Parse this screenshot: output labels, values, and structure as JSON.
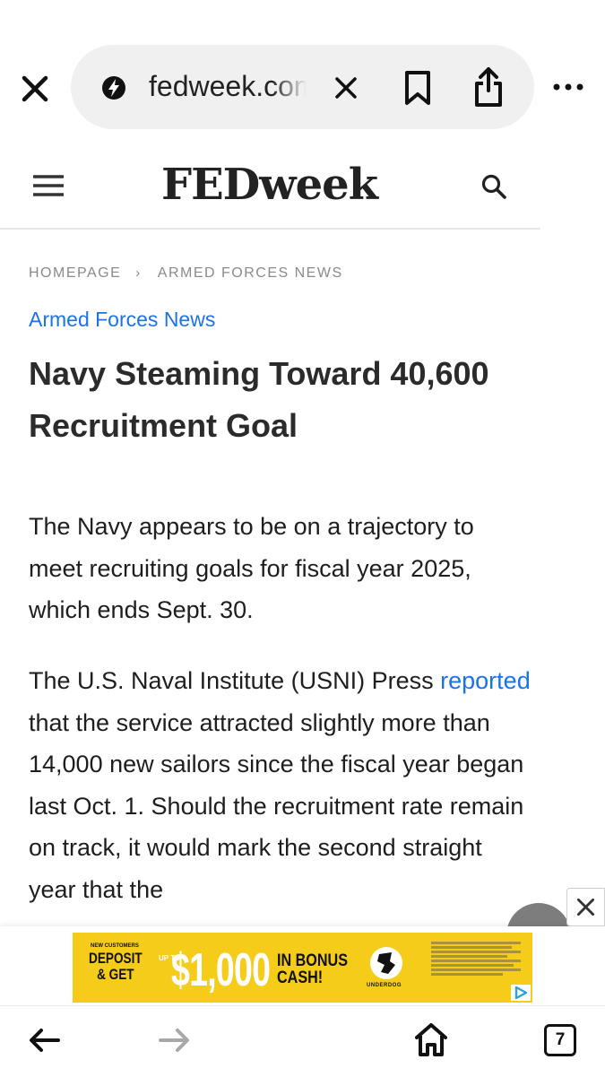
{
  "browser": {
    "url_text": "fedweek.com",
    "open_tabs_count": "7",
    "icons": {
      "close": "close-icon",
      "site_info": "lightning-bolt-icon",
      "clear_url": "clear-icon",
      "bookmark": "bookmark-icon",
      "share": "share-icon",
      "menu": "more-horizontal-icon",
      "back": "arrow-left-icon",
      "forward": "arrow-right-icon",
      "home": "home-icon"
    }
  },
  "site": {
    "logo_text": "FEDweek",
    "icons": {
      "menu": "hamburger-icon",
      "search": "search-icon"
    }
  },
  "breadcrumb": {
    "home": "HOMEPAGE",
    "separator": "›",
    "section": "ARMED FORCES NEWS"
  },
  "article": {
    "category": "Armed Forces News",
    "title": "Navy Steaming Toward 40,600 Recruitment Goal",
    "paragraph1": "The Navy appears to be on a trajectory to meet recruiting goals for fiscal year 2025, which ends Sept. 30.",
    "paragraph2_before_link": "The U.S. Naval Institute (USNI) Press ",
    "paragraph2_link": "reported",
    "paragraph2_after_link": " that the service attracted slightly more than 14,000 new sailors since the fiscal year began last Oct. 1. Should the recruitment rate remain on track, it would mark the second straight year that the"
  },
  "ad": {
    "new_customers": "NEW CUSTOMERS",
    "deposit_line1": "DEPOSIT",
    "deposit_line2": "& GET",
    "up_to": "UP TO",
    "amount": "$1,000",
    "bonus_line1": "IN BONUS",
    "bonus_line2": "CASH!",
    "brand": "UNDERDOG",
    "background_color": "#f6cc1b"
  },
  "colors": {
    "link": "#1a73e8",
    "url_pill": "#f0f0f0"
  }
}
